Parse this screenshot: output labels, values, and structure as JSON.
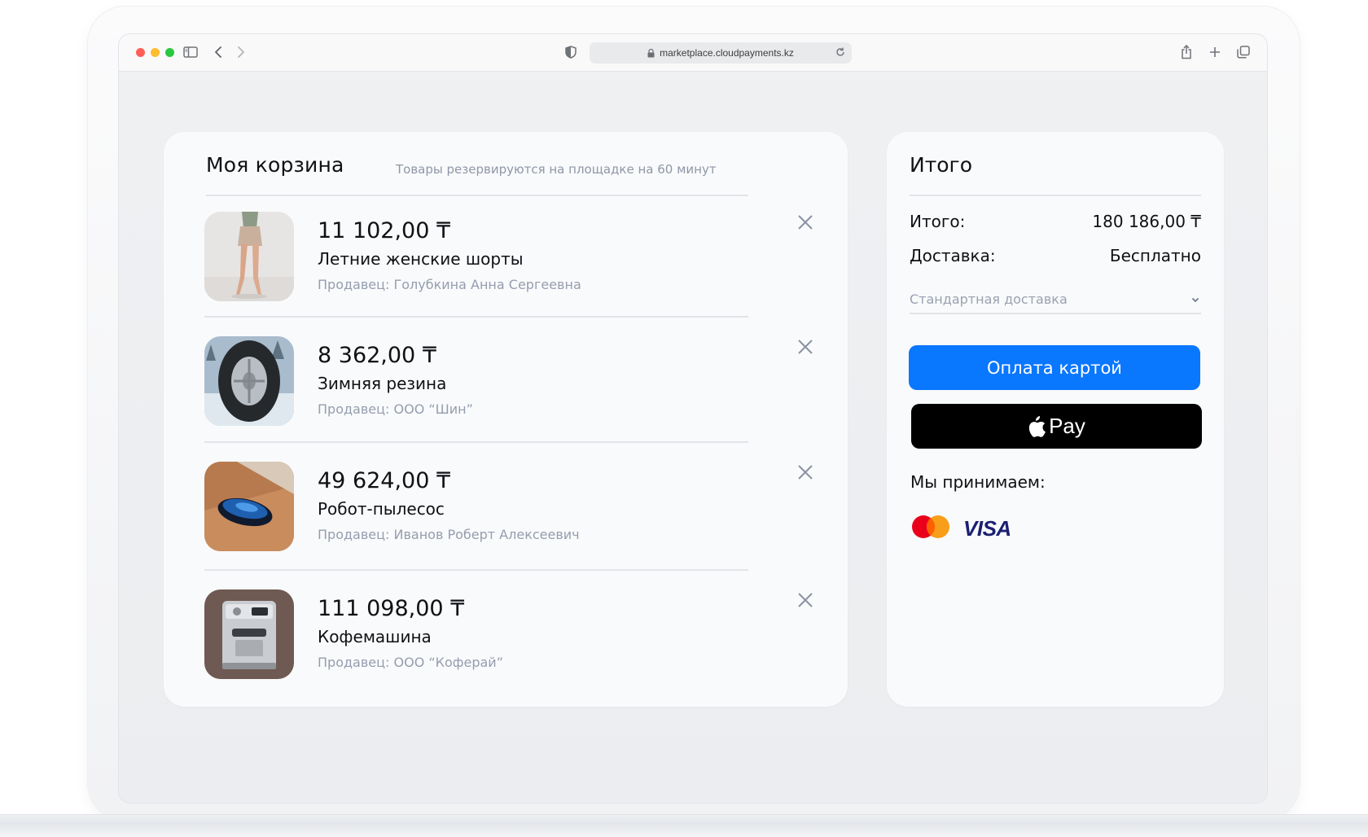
{
  "browser": {
    "url": "marketplace.cloudpayments.kz"
  },
  "cart": {
    "title": "Моя корзина",
    "note": "Товары резервируются на площадке на 60 минут",
    "items": [
      {
        "price": "11 102,00 ₸",
        "name": "Летние женские шорты",
        "seller_label": "Продавец:",
        "seller": "Голубкина Анна Сергеевна",
        "thumb": "woman-shorts-photo"
      },
      {
        "price": "8 362,00 ₸",
        "name": "Зимняя резина",
        "seller_label": "Продавец:",
        "seller": "ООО “Шин”",
        "thumb": "winter-tire-photo"
      },
      {
        "price": "49 624,00 ₸",
        "name": "Робот-пылесос",
        "seller_label": "Продавец:",
        "seller": "Иванов Роберт Алексеевич",
        "thumb": "robot-vacuum-photo"
      },
      {
        "price": "111 098,00 ₸",
        "name": "Кофемашина",
        "seller_label": "Продавец:",
        "seller": "ООО “Коферай”",
        "thumb": "coffee-machine-photo"
      }
    ]
  },
  "summary": {
    "title": "Итого",
    "total_label": "Итого:",
    "total_value": "180 186,00 ₸",
    "delivery_label": "Доставка:",
    "delivery_value": "Бесплатно",
    "delivery_option": "Стандартная доставка",
    "pay_card_label": "Оплата картой",
    "apple_pay_label": "Pay",
    "accept_label": "Мы принимаем:",
    "visa_label": "VISA"
  },
  "colors": {
    "primary": "#0a77ff",
    "muted_text": "#959daf",
    "apple_pay": "#000000"
  }
}
